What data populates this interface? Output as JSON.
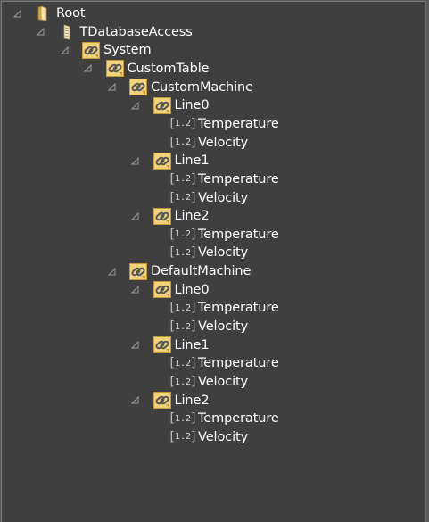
{
  "tree": {
    "root": {
      "label": "Root",
      "icon": "folder-open-icon"
    },
    "database": {
      "label": "TDatabaseAccess",
      "icon": "database-icon"
    },
    "system": {
      "label": "System",
      "icon": "link-object-icon"
    },
    "customTable": {
      "label": "CustomTable",
      "icon": "link-object-icon"
    },
    "customMachine": {
      "label": "CustomMachine",
      "lines": [
        {
          "label": "Line0",
          "vars": [
            "Temperature",
            "Velocity"
          ]
        },
        {
          "label": "Line1",
          "vars": [
            "Temperature",
            "Velocity"
          ]
        },
        {
          "label": "Line2",
          "vars": [
            "Temperature",
            "Velocity"
          ]
        }
      ]
    },
    "defaultMachine": {
      "label": "DefaultMachine",
      "lines": [
        {
          "label": "Line0",
          "vars": [
            "Temperature",
            "Velocity"
          ]
        },
        {
          "label": "Line1",
          "vars": [
            "Temperature",
            "Velocity"
          ]
        },
        {
          "label": "Line2",
          "vars": [
            "Temperature",
            "Velocity"
          ]
        }
      ]
    },
    "var_icon_text": "1.2",
    "colors": {
      "background": "#3f3f3f",
      "text": "#ffffff",
      "folder": "#e8c25a",
      "link_bg": "#f2d27a"
    }
  }
}
